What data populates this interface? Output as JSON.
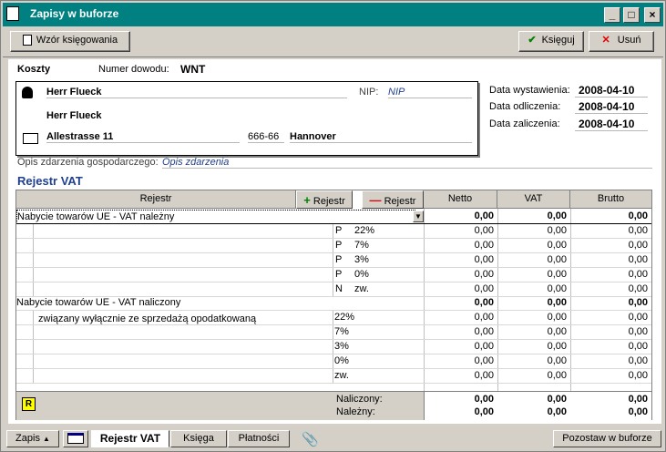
{
  "window": {
    "title": "Zapisy w buforze"
  },
  "toolbar": {
    "wzor": "Wzór księgowania",
    "ksieguj": "Księguj",
    "usun": "Usuń"
  },
  "doc": {
    "category": "Koszty",
    "numer_label": "Numer dowodu:",
    "numer": "WNT",
    "name1": "Herr Flueck",
    "name2": "Herr Flueck",
    "nip_label": "NIP:",
    "nip_placeholder": "NIP",
    "street": "Allestrasse 11",
    "postal": "666-66",
    "city": "Hannover",
    "data_wyst_label": "Data wystawienia:",
    "data_wyst": "2008-04-10",
    "data_odl_label": "Data odliczenia:",
    "data_odl": "2008-04-10",
    "data_zal_label": "Data zaliczenia:",
    "data_zal": "2008-04-10",
    "opis_label": "Opis zdarzenia gospodarczego:",
    "opis_placeholder": "Opis zdarzenia"
  },
  "vat": {
    "section_title": "Rejestr VAT",
    "headers": {
      "rejestr": "Rejestr",
      "add": "Rejestr",
      "remove": "Rejestr",
      "netto": "Netto",
      "vat": "VAT",
      "brutto": "Brutto"
    },
    "group1": {
      "name": "Nabycie towarów UE - VAT należny",
      "netto": "0,00",
      "vat": "0,00",
      "brutto": "0,00",
      "rows": [
        {
          "flag": "P",
          "rate": "22%",
          "netto": "0,00",
          "vat": "0,00",
          "brutto": "0,00"
        },
        {
          "flag": "P",
          "rate": "7%",
          "netto": "0,00",
          "vat": "0,00",
          "brutto": "0,00"
        },
        {
          "flag": "P",
          "rate": "3%",
          "netto": "0,00",
          "vat": "0,00",
          "brutto": "0,00"
        },
        {
          "flag": "P",
          "rate": "0%",
          "netto": "0,00",
          "vat": "0,00",
          "brutto": "0,00"
        },
        {
          "flag": "N",
          "rate": "zw.",
          "netto": "0,00",
          "vat": "0,00",
          "brutto": "0,00"
        }
      ]
    },
    "group2": {
      "name": "Nabycie towarów UE - VAT naliczony",
      "netto": "0,00",
      "vat": "0,00",
      "brutto": "0,00",
      "sub": "związany wyłącznie ze sprzedażą opodatkowaną",
      "rows": [
        {
          "rate": "22%",
          "netto": "0,00",
          "vat": "0,00",
          "brutto": "0,00"
        },
        {
          "rate": "7%",
          "netto": "0,00",
          "vat": "0,00",
          "brutto": "0,00"
        },
        {
          "rate": "3%",
          "netto": "0,00",
          "vat": "0,00",
          "brutto": "0,00"
        },
        {
          "rate": "0%",
          "netto": "0,00",
          "vat": "0,00",
          "brutto": "0,00"
        },
        {
          "rate": "zw.",
          "netto": "0,00",
          "vat": "0,00",
          "brutto": "0,00"
        }
      ]
    },
    "summary": {
      "naliczony_label": "Naliczony:",
      "nalezny_label": "Należny:",
      "naliczony": {
        "netto": "0,00",
        "vat": "0,00",
        "brutto": "0,00"
      },
      "nalezny": {
        "netto": "0,00",
        "vat": "0,00",
        "brutto": "0,00"
      },
      "r_badge": "R"
    }
  },
  "tabs": {
    "zapis": "Zapis",
    "rejestr_vat": "Rejestr VAT",
    "ksiega": "Księga",
    "platnosci": "Płatności",
    "pozostaw": "Pozostaw w buforze"
  }
}
